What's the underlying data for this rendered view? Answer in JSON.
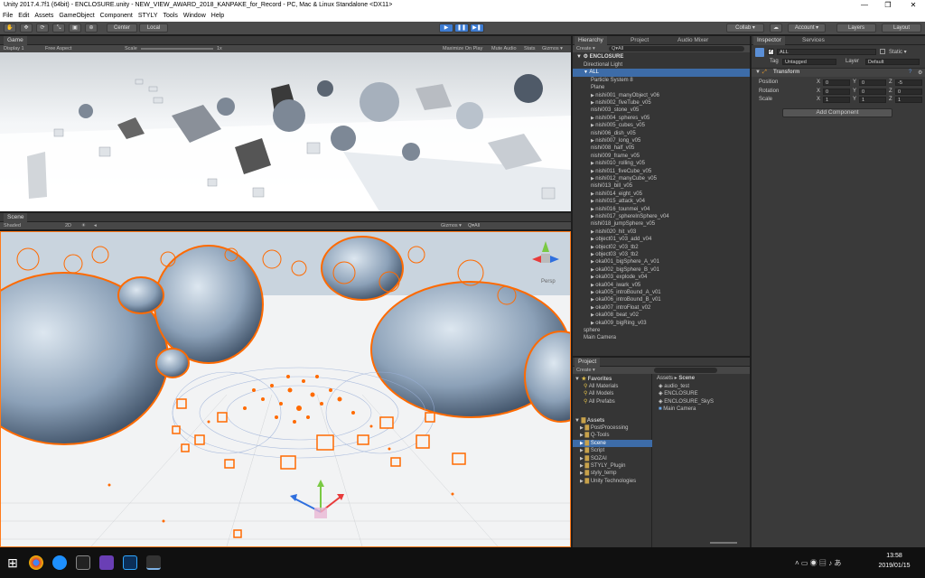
{
  "window": {
    "title": "Unity 2017.4.7f1 (64bit) - ENCLOSURE.unity - NEW_VIEW_AWARD_2018_KANPAKE_for_Record - PC, Mac & Linux Standalone <DX11>",
    "minimize": "—",
    "maximize": "❐",
    "close": "✕"
  },
  "menu": [
    "File",
    "Edit",
    "Assets",
    "GameObject",
    "Component",
    "STYLY",
    "Tools",
    "Window",
    "Help"
  ],
  "toolbar": {
    "pivot": "Center",
    "space": "Local",
    "play": "▶",
    "pause": "❚❚",
    "step": "▶❚",
    "collab": "Collab ▾",
    "account": "Account ▾",
    "layers": "Layers",
    "layout": "Layout"
  },
  "game": {
    "tab": "Game",
    "display": "Display 1",
    "aspect": "Free Aspect",
    "scale_label": "Scale",
    "scale_value": "1x",
    "options": [
      "Maximize On Play",
      "Mute Audio",
      "Stats",
      "Gizmos ▾"
    ]
  },
  "scene": {
    "tab": "Scene",
    "shaded": "Shaded",
    "mode2d": "2D",
    "gizmos": "Gizmos ▾",
    "search": "Q▾All",
    "persp": "Persp"
  },
  "hierarchy": {
    "tabs": [
      "Hierarchy",
      "Project",
      "Audio Mixer"
    ],
    "create": "Create ▾",
    "search": "Q▾All",
    "root": "ENCLOSURE",
    "items": [
      {
        "label": "Directional Light",
        "indent": 1
      },
      {
        "label": "ALL",
        "indent": 1,
        "arrow": "▼",
        "selected": true
      },
      {
        "label": "Particle System 8",
        "indent": 2
      },
      {
        "label": "Plane",
        "indent": 2
      },
      {
        "label": "nishi001_manyObject_v06",
        "indent": 2,
        "arrow": "▶"
      },
      {
        "label": "nishi002_fiveTube_v05",
        "indent": 2,
        "arrow": "▶"
      },
      {
        "label": "nishi003_stone_v05",
        "indent": 2
      },
      {
        "label": "nishi004_spheres_v05",
        "indent": 2,
        "arrow": "▶"
      },
      {
        "label": "nishi005_cubes_v05",
        "indent": 2,
        "arrow": "▶"
      },
      {
        "label": "nishi006_dish_v05",
        "indent": 2
      },
      {
        "label": "nishi007_long_v05",
        "indent": 2,
        "arrow": "▶"
      },
      {
        "label": "nishi008_half_v05",
        "indent": 2
      },
      {
        "label": "nishi009_frame_v05",
        "indent": 2
      },
      {
        "label": "nishi010_rolling_v05",
        "indent": 2,
        "arrow": "▶"
      },
      {
        "label": "nishi011_fiveCube_v05",
        "indent": 2,
        "arrow": "▶"
      },
      {
        "label": "nishi012_manyCube_v05",
        "indent": 2,
        "arrow": "▶"
      },
      {
        "label": "nishi013_bill_v05",
        "indent": 2
      },
      {
        "label": "nishi014_eight_v05",
        "indent": 2,
        "arrow": "▶"
      },
      {
        "label": "nishi015_attack_v04",
        "indent": 2,
        "arrow": "▶"
      },
      {
        "label": "nishi016_tounmei_v04",
        "indent": 2,
        "arrow": "▶"
      },
      {
        "label": "nishi017_sphereInSphere_v04",
        "indent": 2,
        "arrow": "▶"
      },
      {
        "label": "nishi018_jumpSphere_v05",
        "indent": 2
      },
      {
        "label": "nishi020_hit_v03",
        "indent": 2,
        "arrow": "▶"
      },
      {
        "label": "object01_v03_add_v04",
        "indent": 2,
        "arrow": "▶"
      },
      {
        "label": "object02_v03_tb2",
        "indent": 2,
        "arrow": "▶"
      },
      {
        "label": "object03_v03_tb2",
        "indent": 2,
        "arrow": "▶"
      },
      {
        "label": "oka001_bigSphere_A_v01",
        "indent": 2,
        "arrow": "▶"
      },
      {
        "label": "oka002_bigSphere_B_v01",
        "indent": 2,
        "arrow": "▶"
      },
      {
        "label": "oka003_explode_v04",
        "indent": 2,
        "arrow": "▶"
      },
      {
        "label": "oka004_iwark_v05",
        "indent": 2,
        "arrow": "▶"
      },
      {
        "label": "oka005_introBound_A_v01",
        "indent": 2,
        "arrow": "▶"
      },
      {
        "label": "oka006_introBound_B_v01",
        "indent": 2,
        "arrow": "▶"
      },
      {
        "label": "oka007_introFloat_v02",
        "indent": 2,
        "arrow": "▶"
      },
      {
        "label": "oka008_beat_v02",
        "indent": 2,
        "arrow": "▶"
      },
      {
        "label": "oka009_bigRing_v03",
        "indent": 2,
        "arrow": "▶"
      },
      {
        "label": "sphere",
        "indent": 1
      },
      {
        "label": "Main Camera",
        "indent": 1
      }
    ]
  },
  "project": {
    "tab": "Project",
    "create": "Create ▾",
    "favorites": {
      "label": "Favorites",
      "items": [
        "All Materials",
        "All Models",
        "All Prefabs"
      ]
    },
    "assets": {
      "label": "Assets",
      "items": [
        "PostProcessing",
        "Q-Tools",
        "Scene",
        "Script",
        "SOZAI",
        "STYLY_Plugin",
        "styly_temp",
        "Unity Technologies"
      ],
      "selected": "Scene"
    },
    "breadcrumb": [
      "Assets",
      "Scene"
    ],
    "files": [
      "audio_test",
      "ENCLOSURE",
      "ENCLOSURE_SkyS",
      "Main Camera"
    ]
  },
  "inspector": {
    "tabs": [
      "Inspector",
      "Services"
    ],
    "object_name": "ALL",
    "static": "Static ▾",
    "tag_label": "Tag",
    "tag_value": "Untagged",
    "layer_label": "Layer",
    "layer_value": "Default",
    "component": "Transform",
    "rows": [
      {
        "label": "Position",
        "x": "0",
        "y": "0",
        "z": "-5"
      },
      {
        "label": "Rotation",
        "x": "0",
        "y": "0",
        "z": "0"
      },
      {
        "label": "Scale",
        "x": "1",
        "y": "1",
        "z": "1"
      }
    ],
    "add_component": "Add Component"
  },
  "taskbar": {
    "time": "13:58",
    "date": "2019/01/15"
  },
  "colors": {
    "selection": "#3d6ca8",
    "accent": "#ff7a1a",
    "play": "#3d7bd1"
  }
}
